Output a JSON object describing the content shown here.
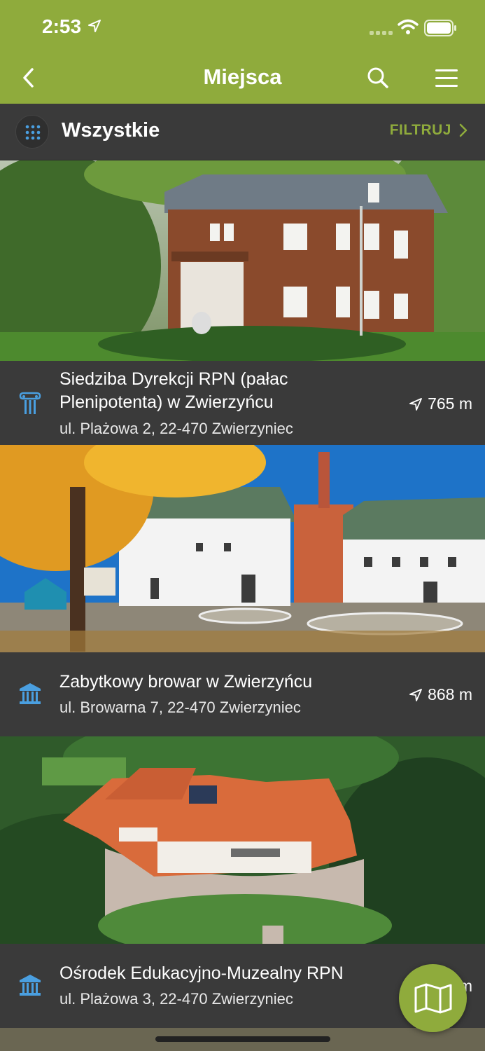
{
  "status": {
    "time": "2:53"
  },
  "nav": {
    "title": "Miejsca",
    "back_icon": "chevron-left-icon",
    "search_icon": "search-icon",
    "menu_icon": "hamburger-icon"
  },
  "filter": {
    "label": "Wszystkie",
    "action": "FILTRUJ",
    "grid_icon": "grid-dots-icon"
  },
  "colors": {
    "brand": "#8fab3c",
    "panel": "#3a3a3a",
    "icon_blue": "#4a9fe0"
  },
  "places": [
    {
      "title": "Siedziba Dyrekcji RPN (pałac Plenipotenta) w Zwierzyńcu",
      "address": "ul. Plażowa 2, 22-470 Zwierzyniec",
      "distance": "765 m",
      "icon": "column-icon"
    },
    {
      "title": "Zabytkowy browar w Zwierzyńcu",
      "address": "ul. Browarna 7, 22-470 Zwierzyniec",
      "distance": "868 m",
      "icon": "museum-icon"
    },
    {
      "title": "Ośrodek Edukacyjno-Muzealny RPN",
      "address": "ul. Plażowa 3, 22-470 Zwierzyniec",
      "distance": "m",
      "icon": "museum-icon"
    }
  ],
  "map_button": {
    "icon": "map-icon"
  }
}
